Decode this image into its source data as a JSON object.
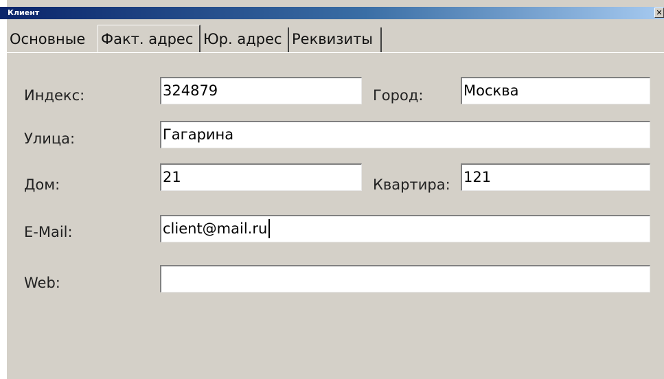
{
  "window": {
    "title": "Клиент",
    "close_glyph": "✕"
  },
  "tabs": [
    {
      "label": "Основные",
      "active": false
    },
    {
      "label": "Факт. адрес",
      "active": true
    },
    {
      "label": "Юр. адрес",
      "active": false
    },
    {
      "label": "Реквизиты",
      "active": false
    }
  ],
  "form": {
    "index": {
      "label": "Индекс:",
      "value": "324879"
    },
    "city": {
      "label": "Город:",
      "value": "Москва"
    },
    "street": {
      "label": "Улица:",
      "value": "Гагарина"
    },
    "house": {
      "label": "Дом:",
      "value": "21"
    },
    "apartment": {
      "label": "Квартира:",
      "value": "121"
    },
    "email": {
      "label": "E-Mail:",
      "value": "client@mail.ru"
    },
    "web": {
      "label": "Web:",
      "value": ""
    }
  },
  "colors": {
    "dialog_bg": "#d4d0c8",
    "titlebar_start": "#0a246a",
    "titlebar_end": "#a6caf0"
  }
}
